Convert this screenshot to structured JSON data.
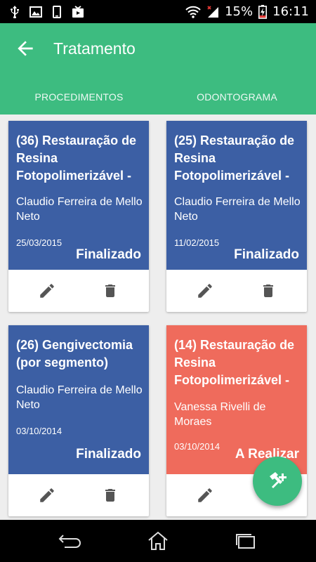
{
  "status_bar": {
    "battery": "15%",
    "time": "16:11",
    "icons": [
      "usb-icon",
      "image-icon",
      "phone-icon",
      "video-icon",
      "wifi-icon",
      "signal-icon",
      "battery-charging-icon"
    ]
  },
  "app_bar": {
    "title": "Tratamento",
    "back_icon": "arrow-back-icon",
    "color": "#3dbc80"
  },
  "tabs": [
    {
      "label": "PROCEDIMENTOS",
      "selected": true
    },
    {
      "label": "ODONTOGRAMA",
      "selected": false
    }
  ],
  "cards": [
    {
      "title": "(36) Restauração de Resina Fotopolimerizável -",
      "doctor": "Claudio Ferreira de Mello Neto",
      "date": "25/03/2015",
      "status": "Finalizado",
      "color": "#3c5fa4"
    },
    {
      "title": "(25) Restauração de Resina Fotopolimerizável -",
      "doctor": "Claudio Ferreira de Mello Neto",
      "date": "11/02/2015",
      "status": "Finalizado",
      "color": "#3c5fa4"
    },
    {
      "title": "(26) Gengivectomia (por segmento)",
      "doctor": "Claudio Ferreira de Mello Neto",
      "date": "03/10/2014",
      "status": "Finalizado",
      "color": "#3c5fa4"
    },
    {
      "title": "(14) Restauração de Resina Fotopolimerizável -",
      "doctor": "Vanessa Rivelli de Moraes",
      "date": "03/10/2014",
      "status": "A Realizar",
      "color": "#ef6b5c"
    }
  ],
  "card_actions": {
    "edit_icon": "pencil-icon",
    "delete_icon": "trash-icon"
  },
  "fab": {
    "icon": "tools-add-icon",
    "color": "#3dbc80"
  },
  "nav_bar": {
    "icons": [
      "back-icon",
      "home-icon",
      "recent-apps-icon"
    ]
  }
}
